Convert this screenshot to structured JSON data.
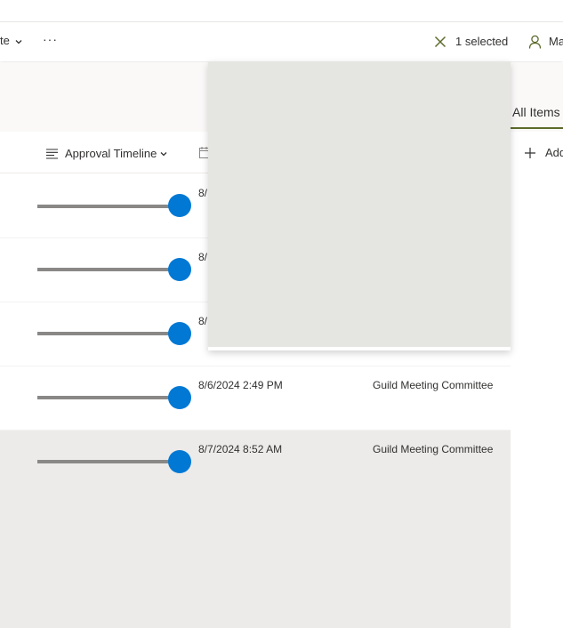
{
  "command_bar": {
    "truncated_left_label": "te",
    "more_label": "···",
    "selection_text": "1 selected",
    "user_truncated": "Ma"
  },
  "view": {
    "active_tab": "All Items"
  },
  "columns": {
    "approval_timeline": "Approval Timeline",
    "add_column": "Add"
  },
  "rows": [
    {
      "progress": 1.0,
      "date": "8/",
      "org": ""
    },
    {
      "progress": 1.0,
      "date": "8/",
      "org": ""
    },
    {
      "progress": 1.0,
      "date": "8/",
      "org": ""
    },
    {
      "progress": 1.0,
      "date": "8/6/2024 2:49 PM",
      "org": "Guild Meeting Committee"
    },
    {
      "progress": 1.0,
      "date": "8/7/2024 8:52 AM",
      "org": "Guild Meeting Committee",
      "selected": true
    }
  ],
  "colors": {
    "accent": "#0078d4",
    "view_underline": "#5c6a2b",
    "selection_icon": "#5c6a2b",
    "selected_row": "#edebe9",
    "callout": "#e5e5e1"
  },
  "icons": {
    "close": "close-icon",
    "person": "person-icon",
    "chevron": "chevron-down-icon",
    "text_column": "text-lines-icon",
    "calendar": "calendar-icon",
    "plus": "plus-icon"
  }
}
